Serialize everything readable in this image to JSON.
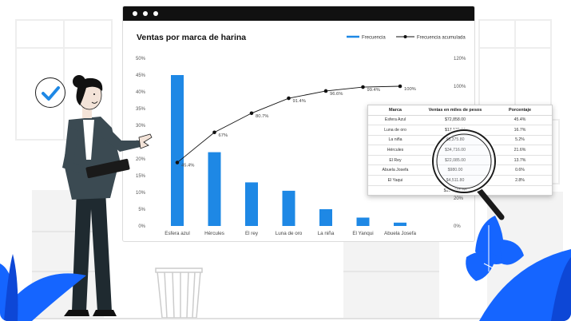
{
  "window": {
    "title": "Ventas por marca de harina"
  },
  "legend": {
    "bar_label": "Frecuencia",
    "line_label": "Frecuencia acumulada"
  },
  "colors": {
    "bar": "#1e88e5",
    "line": "#111111",
    "plant": "#1565ff",
    "titlebar": "#111111"
  },
  "chart_data": {
    "type": "bar",
    "title": "Ventas por marca de harina",
    "categories": [
      "Esfera azul",
      "Hércules",
      "El rey",
      "Luna de oro",
      "La niña",
      "El Yanqui",
      "Abuela Josefa"
    ],
    "series": [
      {
        "name": "Frecuencia",
        "type": "bar",
        "axis": "left",
        "values": [
          45,
          22,
          13,
          10.5,
          5,
          2.5,
          1
        ]
      },
      {
        "name": "Frecuencia acumulada",
        "type": "line",
        "axis": "right",
        "values": [
          45.4,
          67,
          80.7,
          91.4,
          96.6,
          99.4,
          100
        ],
        "labels": [
          "45.4%",
          "67%",
          "80.7%",
          "91.4%",
          "96.6%",
          "99.4%",
          "100%"
        ]
      }
    ],
    "ylim": [
      0,
      50
    ],
    "y_ticks": [
      "0%",
      "5%",
      "10%",
      "15%",
      "20%",
      "25%",
      "30%",
      "35%",
      "40%",
      "45%",
      "50%"
    ],
    "y2lim": [
      0,
      120
    ],
    "y2_ticks": [
      "0%",
      "20%",
      "40%",
      "60%",
      "80%",
      "100%",
      "120%"
    ],
    "legend_position": "top-right",
    "grid": false
  },
  "table": {
    "headers": [
      "Marca",
      "Ventas en miles de pesos",
      "Porcentaje"
    ],
    "rows": [
      [
        "Esfera Azul",
        "$72,858.00",
        "45.4%"
      ],
      [
        "Luna de oro",
        "$17,131.00",
        "16.7%"
      ],
      [
        "La niña",
        "$8,375.80",
        "5.2%"
      ],
      [
        "Hércules",
        "$34,716.00",
        "21.6%"
      ],
      [
        "El Rey",
        "$22,085.00",
        "13.7%"
      ],
      [
        "Abuela Josefa",
        "$980.00",
        "0.6%"
      ],
      [
        "El Yaqui",
        "$4,511.80",
        "2.8%"
      ]
    ],
    "total": "$160,691.00"
  },
  "icons": {
    "check": "check-icon",
    "magnifier": "magnifying-glass-icon"
  }
}
